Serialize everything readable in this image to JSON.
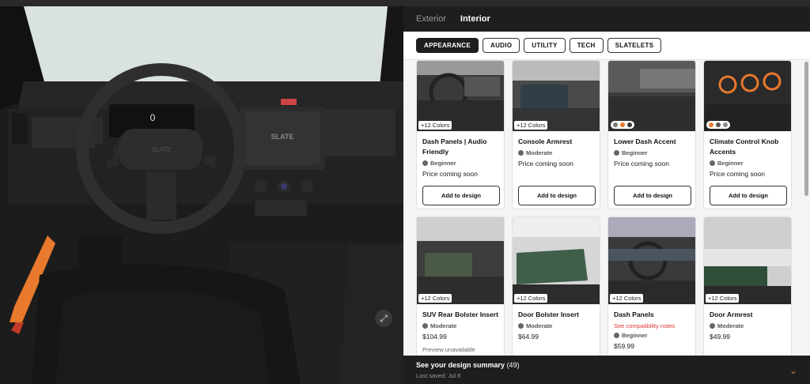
{
  "tabs": [
    {
      "label": "Exterior",
      "active": false
    },
    {
      "label": "Interior",
      "active": true
    }
  ],
  "subtabs": [
    {
      "label": "APPEARANCE",
      "active": true
    },
    {
      "label": "AUDIO",
      "active": false
    },
    {
      "label": "UTILITY",
      "active": false
    },
    {
      "label": "TECH",
      "active": false
    },
    {
      "label": "SLATELETS",
      "active": false
    }
  ],
  "viewer": {
    "speed_display": "0",
    "wheel_logo": "SLATE",
    "screen_logo": "SLATE"
  },
  "cards": [
    {
      "title": "Dash Panels | Audio Friendly",
      "badge": "+12 Colors",
      "level": "Beginner",
      "price": "Price coming soon",
      "button": "Add to design"
    },
    {
      "title": "Console Armrest",
      "badge": "+12 Colors",
      "level": "Moderate",
      "price": "Price coming soon",
      "button": "Add to design"
    },
    {
      "title": "Lower Dash Accent",
      "level": "Beginner",
      "price": "Price coming soon",
      "button": "Add to design",
      "swatches": [
        "#777777",
        "#e8792d",
        "#3a3a3a"
      ]
    },
    {
      "title": "Climate Control Knob Accents",
      "level": "Beginner",
      "price": "Price coming soon",
      "button": "Add to design",
      "swatches": [
        "#e8792d",
        "#555555",
        "#888888"
      ]
    },
    {
      "title": "SUV Rear Bolster Insert",
      "badge": "+12 Colors",
      "level": "Moderate",
      "price": "$104.99",
      "note": "Preview unavailable"
    },
    {
      "title": "Door Bolster Insert",
      "badge": "+12 Colors",
      "level": "Moderate",
      "price": "$64.99"
    },
    {
      "title": "Dash Panels",
      "badge": "+12 Colors",
      "compat": "See compatibility notes",
      "level": "Beginner",
      "price": "$59.99"
    },
    {
      "title": "Door Armrest",
      "badge": "+12 Colors",
      "level": "Moderate",
      "price": "$49.99"
    }
  ],
  "summary": {
    "title": "See your design summary",
    "count": "(49)",
    "saved": "Last saved: Jul 8"
  },
  "colors": {
    "accent": "#e8792d",
    "dark": "#1e1e1e",
    "warning": "#dd3333"
  }
}
